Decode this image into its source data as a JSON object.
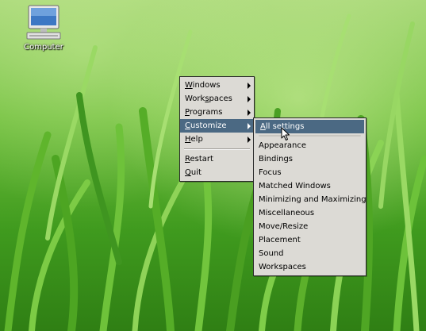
{
  "desktop": {
    "icons": [
      {
        "label": "Computer",
        "icon": "computer-icon"
      }
    ],
    "wallpaper": "green grass"
  },
  "root_menu": {
    "items": [
      {
        "label": "Windows",
        "mnemonic": "W",
        "rest": "indows",
        "submenu": true
      },
      {
        "label": "Workspaces",
        "pre": "Work",
        "mnemonic": "s",
        "rest": "paces",
        "submenu": true
      },
      {
        "label": "Programs",
        "mnemonic": "P",
        "rest": "rograms",
        "submenu": true
      },
      {
        "label": "Customize",
        "mnemonic": "C",
        "rest": "ustomize",
        "submenu": true,
        "active": true
      },
      {
        "label": "Help",
        "mnemonic": "H",
        "rest": "elp",
        "submenu": true
      },
      {
        "label": "Restart",
        "mnemonic": "R",
        "rest": "estart"
      },
      {
        "label": "Quit",
        "mnemonic": "Q",
        "rest": "uit"
      }
    ]
  },
  "customize_menu": {
    "title_item": {
      "label": "All settings",
      "mnemonic": "A",
      "rest": "ll settings"
    },
    "items": [
      "Appearance",
      "Bindings",
      "Focus",
      "Matched Windows",
      "Minimizing and Maximizing",
      "Miscellaneous",
      "Move/Resize",
      "Placement",
      "Sound",
      "Workspaces"
    ]
  },
  "colors": {
    "menu_bg": "#dcdad5",
    "highlight": "#4b6983",
    "border": "#2b2b2b"
  }
}
